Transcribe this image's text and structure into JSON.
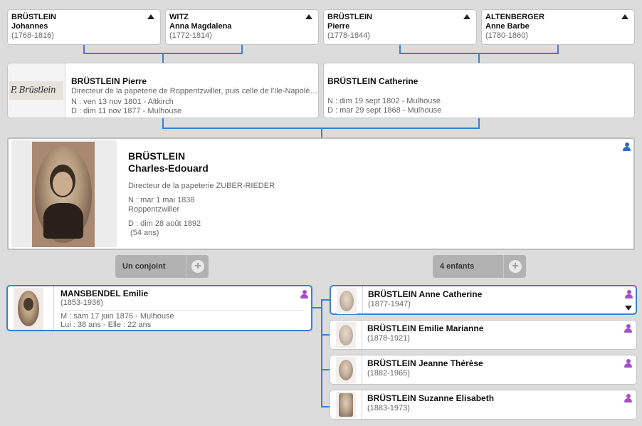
{
  "colors": {
    "link_line": "#3d7fcf",
    "female_icon": "#a64ec9",
    "male_icon": "#2f6bbf"
  },
  "grandparents": [
    {
      "surname": "BRÜSTLEIN",
      "given": "Johannes",
      "life": "(1768-1816)"
    },
    {
      "surname": "WITZ",
      "given": "Anna Magdalena",
      "life": "(1772-1814)"
    },
    {
      "surname": "BRÜSTLEIN",
      "given": "Pierre",
      "life": "(1778-1844)"
    },
    {
      "surname": "ALTENBERGER",
      "given": "Anne Barbe",
      "life": "(1780-1860)"
    }
  ],
  "father": {
    "name": "BRÜSTLEIN Pierre",
    "occupation": "Directeur de la papeterie de Roppentzwiller, puis celle de l'Ile-Napolé…",
    "birth": "N : ven 13 nov 1801 - Altkirch",
    "death": "D : dim 11 nov 1877 - Mulhouse",
    "signature": "P. Brüstlein"
  },
  "mother": {
    "name": "BRÜSTLEIN Catherine",
    "birth": "N : dim 19 sept 1802 - Mulhouse",
    "death": "D : mar 29 sept 1868 - Mulhouse"
  },
  "main": {
    "surname": "BRÜSTLEIN",
    "given": "Charles-Edouard",
    "occupation": "Directeur de la papeterie ZUBER-RIEDER",
    "birth_line": "N : mar 1 mai 1838",
    "birth_place": "Roppentzwiller",
    "death_line": "D : dim 28 août 1892",
    "age": " (54 ans)",
    "icon": "male-person-icon"
  },
  "spouse_pill": {
    "label": "Un conjoint"
  },
  "children_pill": {
    "label": "4 enfants"
  },
  "spouse": {
    "name": "MANSBENDEL Emilie",
    "life": "(1853-1936)",
    "marriage": "M : sam 17 juin 1876 - Mulhouse",
    "ages": "Lui : 38 ans - Elle : 22 ans",
    "icon": "female-person-icon"
  },
  "children": [
    {
      "name": "BRÜSTLEIN Anne Catherine",
      "life": "(1877-1947)"
    },
    {
      "name": "BRÜSTLEIN Emilie Marianne",
      "life": "(1878-1921)"
    },
    {
      "name": "BRÜSTLEIN Jeanne Thérèse",
      "life": "(1882-1965)"
    },
    {
      "name": "BRÜSTLEIN Suzanne Elisabeth",
      "life": "(1883-1973)"
    }
  ]
}
